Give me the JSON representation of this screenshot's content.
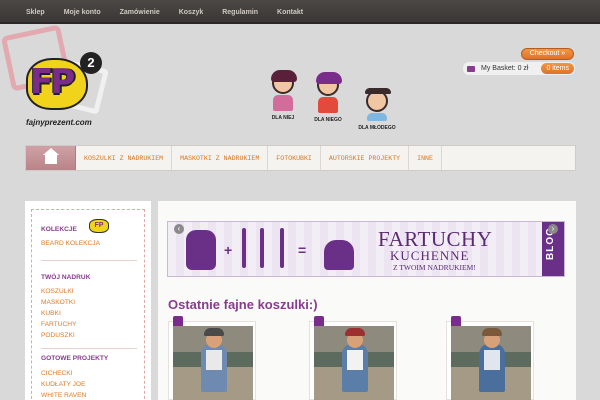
{
  "topnav": [
    "Sklep",
    "Moje konto",
    "Zamówienie",
    "Koszyk",
    "Regulamin",
    "Kontakt"
  ],
  "logo": {
    "text": "FP",
    "sup": "2",
    "site": "fajnyprezent.com"
  },
  "kids": [
    "DLA NIEJ",
    "DLA NIEGO",
    "DLA MŁODEGO"
  ],
  "header": {
    "checkout": "Checkout »",
    "basket_label": "My Basket: 0 zł",
    "items": "0 items"
  },
  "mainnav": [
    "KOSZULKI Z NADRUKIEM",
    "MASKOTKI Z NADRUKIEM",
    "FOTOKUBKI",
    "AUTORSKIE PROJEKTY",
    "INNE"
  ],
  "sidebar": {
    "kolekcje_title": "KOLEKCJE",
    "kolekcje_items": [
      "BEARD KOLEKCJA"
    ],
    "nadruk_title": "TWÓJ NADRUK",
    "nadruk_items": [
      "KOSZULKI",
      "MASKOTKI",
      "KUBKI",
      "FARTUCHY",
      "PODUSZKI"
    ],
    "projekty_title": "GOTOWE PROJEKTY",
    "projekty_items": [
      "CICHECKI",
      "KUDŁATY JOE",
      "WHITE RAVEN"
    ]
  },
  "banner": {
    "title": "FARTUCHY",
    "subtitle": "KUCHENNE",
    "tagline": "Z TWOIM NADRUKIEM!",
    "side": "BLOG",
    "prev": "‹",
    "next": "›"
  },
  "content": {
    "heading": "Ostatnie fajne koszulki:)"
  },
  "colors": {
    "accent": "#e07a23",
    "brand": "#8a3b8f",
    "topbar": "#4b4845"
  }
}
